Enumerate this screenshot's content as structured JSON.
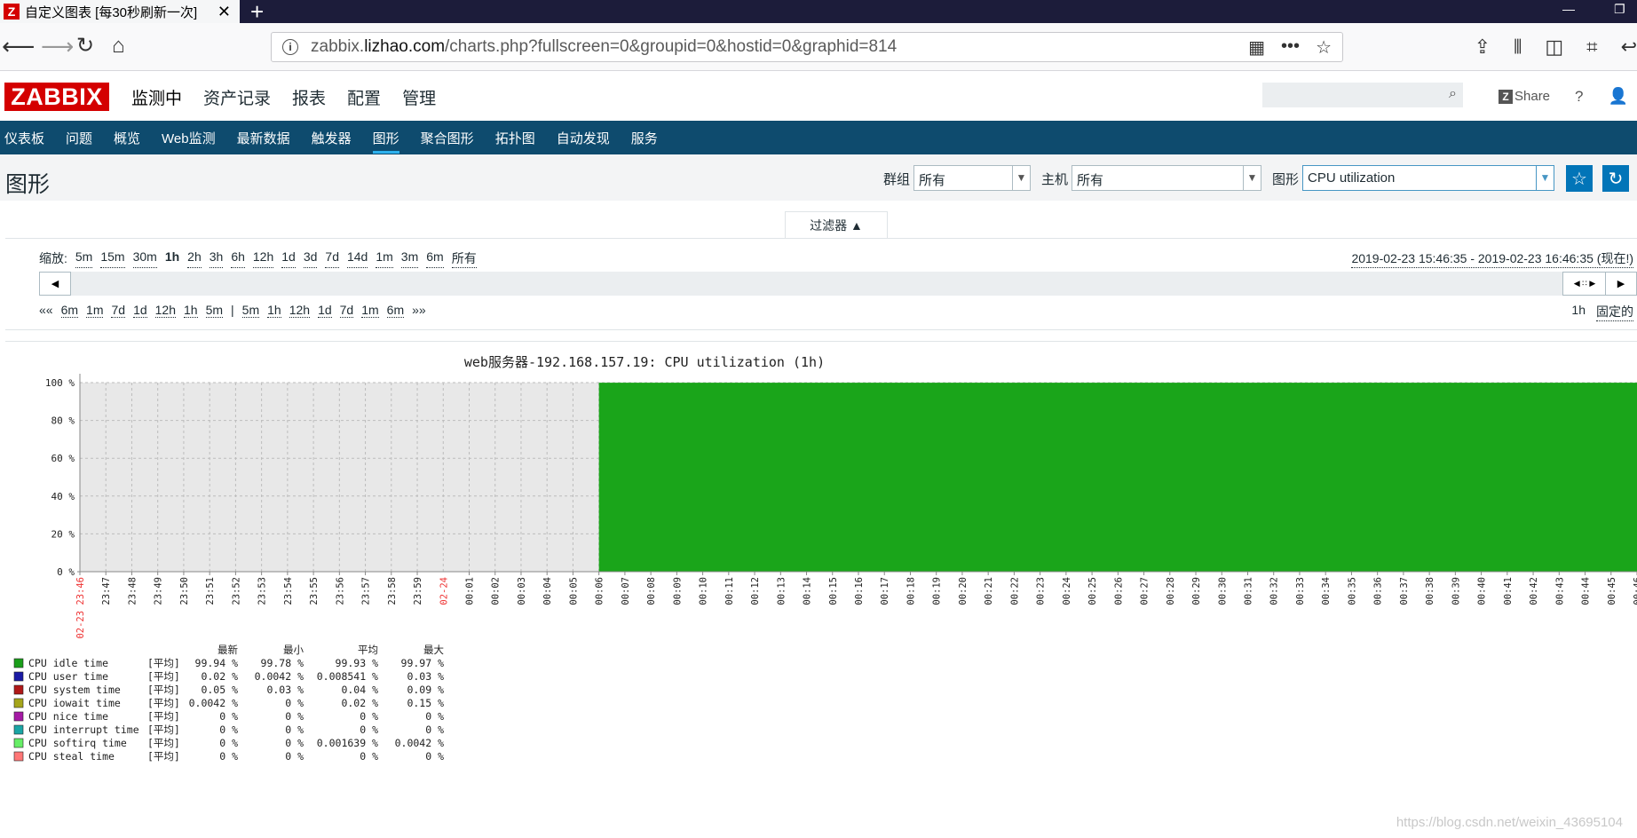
{
  "browser": {
    "tab_title": "自定义图表 [每30秒刷新一次]",
    "tab_favicon": "Z",
    "url_prefix": "zabbix.",
    "url_host": "lizhao.com",
    "url_path": "/charts.php?fullscreen=0&groupid=0&hostid=0&graphid=814"
  },
  "zabbix": {
    "logo": "ZABBIX",
    "menu": [
      "监测中",
      "资产记录",
      "报表",
      "配置",
      "管理"
    ],
    "share_icon": "Z",
    "share_label": "Share",
    "help_label": "?",
    "subnav": [
      "仪表板",
      "问题",
      "概览",
      "Web监测",
      "最新数据",
      "触发器",
      "图形",
      "聚合图形",
      "拓扑图",
      "自动发现",
      "服务"
    ],
    "subnav_active": "图形"
  },
  "page": {
    "title": "图形",
    "group_label": "群组",
    "group_value": "所有",
    "host_label": "主机",
    "host_value": "所有",
    "graph_label": "图形",
    "graph_value": "CPU utilization"
  },
  "filter": {
    "tab_label": "过滤器 ▲",
    "zoom_label": "缩放:",
    "zoom_options": [
      "5m",
      "15m",
      "30m",
      "1h",
      "2h",
      "3h",
      "6h",
      "12h",
      "1d",
      "3d",
      "7d",
      "14d",
      "1m",
      "3m",
      "6m",
      "所有"
    ],
    "zoom_active": "1h",
    "time_range": "2019-02-23 15:46:35 - 2019-02-23 16:46:35 (现在!)",
    "nav_back_label": "««",
    "nav_back": [
      "6m",
      "1m",
      "7d",
      "1d",
      "12h",
      "1h",
      "5m"
    ],
    "nav_separator": "|",
    "nav_fwd": [
      "5m",
      "1h",
      "12h",
      "1d",
      "7d",
      "1m",
      "6m"
    ],
    "nav_fwd_label": "»»",
    "period": "1h",
    "fixed_label": "固定的"
  },
  "chart_data": {
    "type": "area",
    "title": "web服务器-192.168.157.19: CPU utilization (1h)",
    "ylim": [
      0,
      100
    ],
    "y_ticks": [
      "100 %",
      "80 %",
      "60 %",
      "40 %",
      "20 %",
      "0 %"
    ],
    "x_labels": [
      "23:47",
      "23:48",
      "23:49",
      "23:50",
      "23:51",
      "23:52",
      "23:53",
      "23:54",
      "23:55",
      "23:56",
      "23:57",
      "23:58",
      "23:59",
      "00:01",
      "00:02",
      "00:03",
      "00:04",
      "00:05",
      "00:06",
      "00:07",
      "00:08",
      "00:09",
      "00:10",
      "00:11",
      "00:12",
      "00:13",
      "00:14",
      "00:15",
      "00:16",
      "00:17",
      "00:18",
      "00:19",
      "00:20",
      "00:21",
      "00:22",
      "00:23",
      "00:24",
      "00:25",
      "00:26",
      "00:27",
      "00:28",
      "00:29",
      "00:30",
      "00:31",
      "00:32",
      "00:33",
      "00:34",
      "00:35",
      "00:36",
      "00:37",
      "00:38",
      "00:39",
      "00:40",
      "00:41",
      "00:42",
      "00:43",
      "00:44",
      "00:45",
      "00:46"
    ],
    "x_red_labels": [
      "02-23 23:46",
      "02-24"
    ],
    "data_start_label": "00:06",
    "data_start_value": 99.94,
    "series_color_idle": "#1aa51a",
    "legend_headers": [
      "最新",
      "最小",
      "平均",
      "最大"
    ],
    "series": [
      {
        "name": "CPU idle time",
        "color": "#1A9E1A",
        "func": "[平均]",
        "last": "99.94 %",
        "min": "99.78 %",
        "avg": "99.93 %",
        "max": "99.97 %"
      },
      {
        "name": "CPU user time",
        "color": "#1A1AA5",
        "func": "[平均]",
        "last": "0.02 %",
        "min": "0.0042 %",
        "avg": "0.008541 %",
        "max": "0.03 %"
      },
      {
        "name": "CPU system time",
        "color": "#B01818",
        "func": "[平均]",
        "last": "0.05 %",
        "min": "0.03 %",
        "avg": "0.04 %",
        "max": "0.09 %"
      },
      {
        "name": "CPU iowait time",
        "color": "#A5A51A",
        "func": "[平均]",
        "last": "0.0042 %",
        "min": "0 %",
        "avg": "0.02 %",
        "max": "0.15 %"
      },
      {
        "name": "CPU nice time",
        "color": "#A51AA5",
        "func": "[平均]",
        "last": "0 %",
        "min": "0 %",
        "avg": "0 %",
        "max": "0 %"
      },
      {
        "name": "CPU interrupt time",
        "color": "#1AA5A5",
        "func": "[平均]",
        "last": "0 %",
        "min": "0 %",
        "avg": "0 %",
        "max": "0 %"
      },
      {
        "name": "CPU softirq time",
        "color": "#66EE66",
        "func": "[平均]",
        "last": "0 %",
        "min": "0 %",
        "avg": "0.001639 %",
        "max": "0.0042 %"
      },
      {
        "name": "CPU steal time",
        "color": "#FF7777",
        "func": "[平均]",
        "last": "0 %",
        "min": "0 %",
        "avg": "0 %",
        "max": "0 %"
      }
    ]
  },
  "watermark": "https://blog.csdn.net/weixin_43695104"
}
